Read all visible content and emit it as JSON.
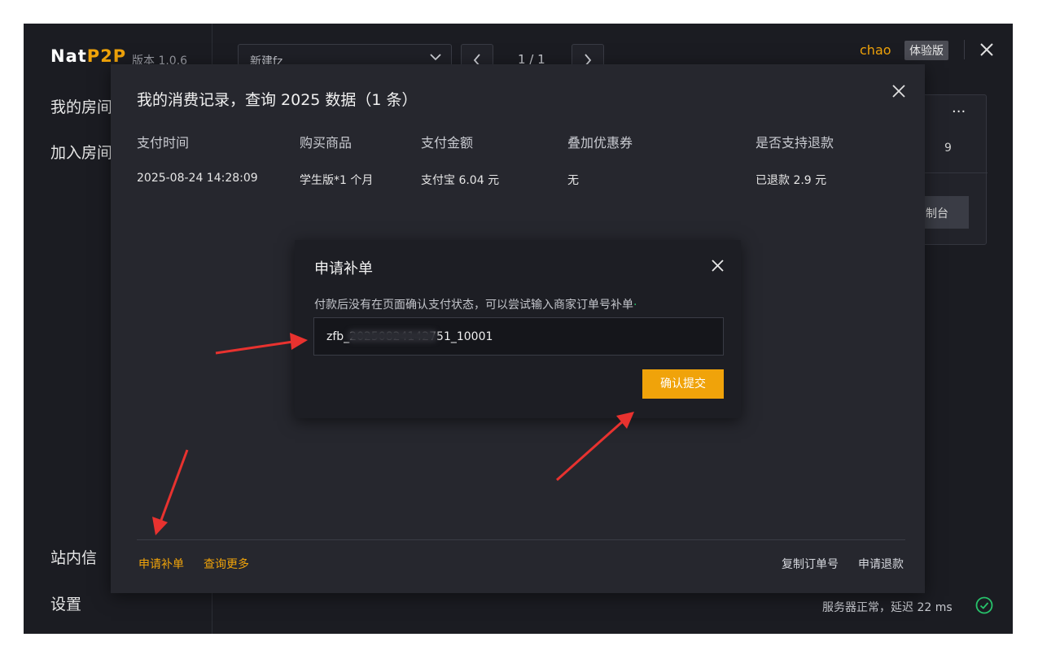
{
  "app": {
    "logo_prefix": "Nat",
    "logo_accent": "P2P",
    "version": "版本 1.0.6",
    "accent_color": "#f0a30a"
  },
  "sidebar": {
    "items": [
      {
        "label": "我的房间"
      },
      {
        "label": "加入房间"
      },
      {
        "label": "站内信"
      },
      {
        "label": "设置"
      }
    ]
  },
  "topbar": {
    "select_value": "新建fz",
    "pager_text": "1 / 1",
    "username": "chao",
    "plan_badge": "体验版"
  },
  "background_card": {
    "menu": "···",
    "digit": "9",
    "button_label": "制台"
  },
  "status_bar": {
    "text": "服务器正常，延迟 22 ms"
  },
  "modal": {
    "title": "我的消费记录，查询 2025 数据（1 条）",
    "columns": [
      "支付时间",
      "购买商品",
      "支付金额",
      "叠加优惠券",
      "是否支持退款"
    ],
    "rows": [
      [
        "2025-08-24 14:28:09",
        "学生版*1 个月",
        "支付宝 6.04 元",
        "无",
        "已退款 2.9 元"
      ]
    ],
    "footer_left": [
      "申请补单",
      "查询更多"
    ],
    "footer_right": [
      "复制订单号",
      "申请退款"
    ]
  },
  "dialog": {
    "title": "申请补单",
    "description": "付款后没有在页面确认支付状态，可以尝试输入商家订单号补单",
    "input_value": "zfb_20250824142751_10001",
    "confirm_label": "确认提交"
  }
}
